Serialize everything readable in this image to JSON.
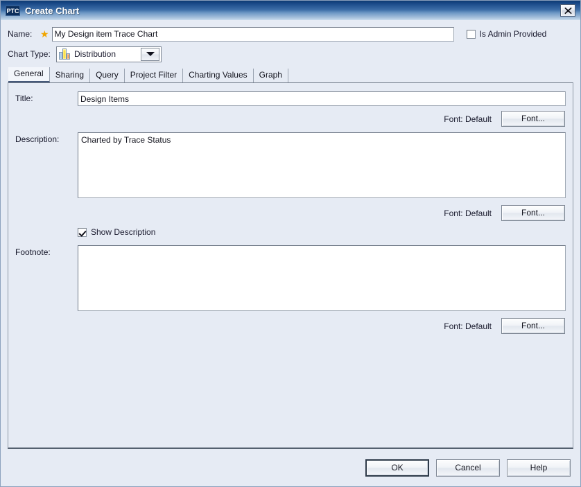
{
  "window": {
    "app_badge": "PTC",
    "title": "Create Chart",
    "close_icon": "close-icon"
  },
  "form": {
    "name_label": "Name:",
    "name_required_marker": "★",
    "name_value": "My Design item Trace Chart",
    "name_placeholder": "",
    "admin_checkbox_label": "Is Admin Provided",
    "admin_checked": false,
    "chart_type_label": "Chart Type:",
    "chart_type_value": "Distribution",
    "chart_type_icon": "bar-chart-icon"
  },
  "tabs": [
    {
      "label": "General",
      "active": true
    },
    {
      "label": "Sharing",
      "active": false
    },
    {
      "label": "Query",
      "active": false
    },
    {
      "label": "Project Filter",
      "active": false
    },
    {
      "label": "Charting Values",
      "active": false
    },
    {
      "label": "Graph",
      "active": false
    }
  ],
  "general": {
    "title_label": "Title:",
    "title_value": "Design Items",
    "title_font_status": "Font: Default",
    "title_font_button": "Font...",
    "description_label": "Description:",
    "description_value": "Charted by Trace Status",
    "description_font_status": "Font: Default",
    "description_font_button": "Font...",
    "show_description_label": "Show Description",
    "show_description_checked": true,
    "footnote_label": "Footnote:",
    "footnote_value": "",
    "footnote_font_status": "Font: Default",
    "footnote_font_button": "Font..."
  },
  "buttons": {
    "ok": "OK",
    "cancel": "Cancel",
    "help": "Help"
  },
  "colors": {
    "titlebar_dark": "#0e3a73",
    "titlebar_light": "#c9dbec",
    "dialog_background": "#e6ebf4",
    "required_star": "#f0a500",
    "text": "#14151f",
    "field_border": "#7d8693",
    "icon_bar_blue": "#9fc8ea",
    "icon_bar_yellow": "#fbe14a",
    "icon_bar_orange": "#f0a05a"
  }
}
